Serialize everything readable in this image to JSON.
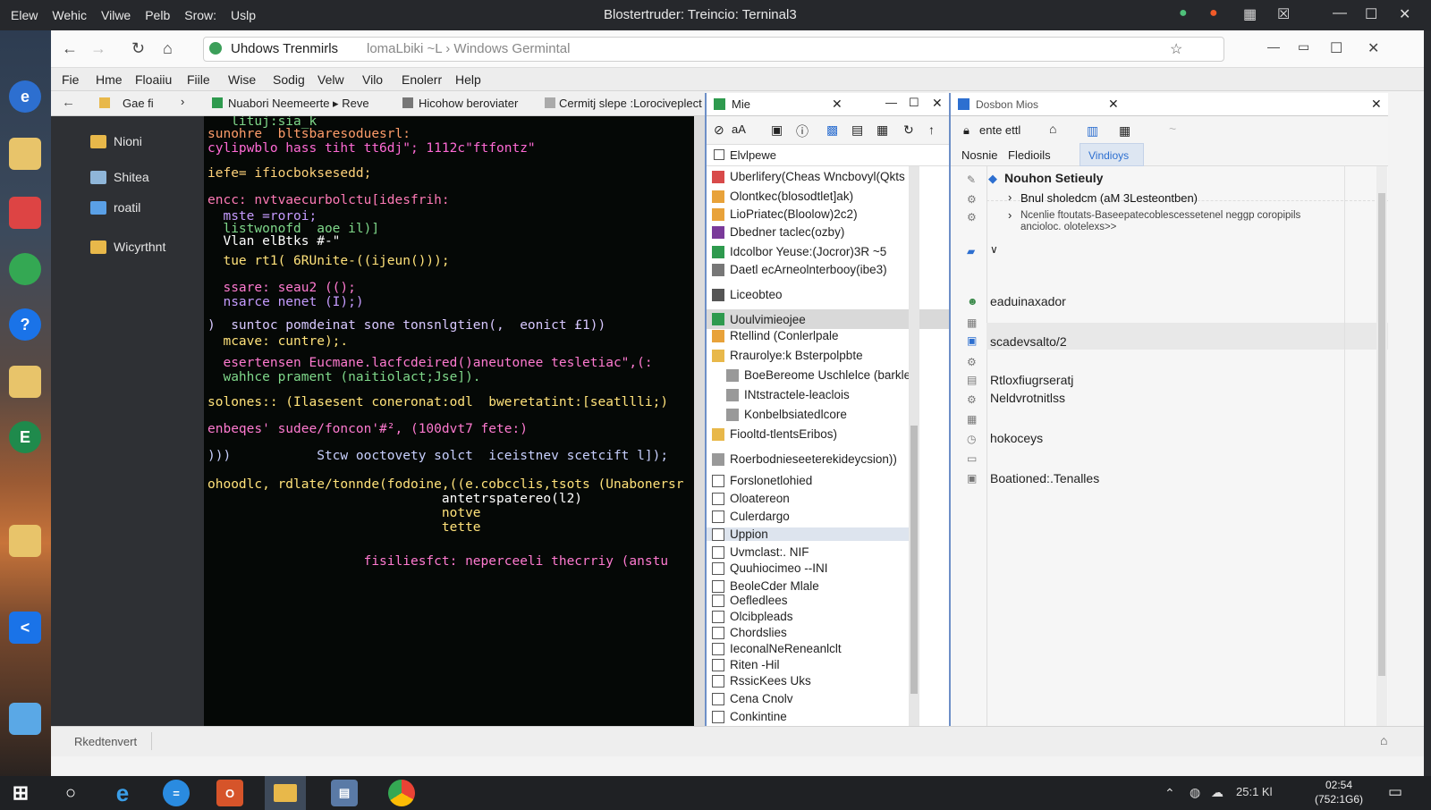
{
  "titlebar": {
    "menu": [
      "Elew",
      "Wehic",
      "Vilwe",
      "Pelb",
      "Srow:",
      "Uslp"
    ],
    "title": "Blostertruder: Treincio: Terninal3"
  },
  "browser": {
    "url_text": "Uhdows Trenmirls",
    "url_extra": "lomaLbiki ~L › Windows Germintal",
    "menu": [
      "Fie",
      "Hme",
      "Floaiiu",
      "Fiile",
      "Wise",
      "Sodig",
      "Velw",
      "Vilo",
      "Enolerr",
      "Help"
    ],
    "tabs": [
      "Gae fi",
      "Nuabori Neemeerte ▸ Reve",
      "Hicohow beroviater",
      "Cermitj slepe :Lorociveplect"
    ]
  },
  "sidebar": {
    "items": [
      "Nioni",
      "Shitea",
      "roatil",
      "Wicyrthnt"
    ]
  },
  "terminal": {
    "lines": [
      {
        "t": "   lituj:sia_k",
        "c": "#7fd88a"
      },
      {
        "t": "sunohre  bltsbaresoduesrl:",
        "c": "#ff9d6a"
      },
      {
        "t": "cylipwblo hass tiht tt6dj\"; 1112c\"ftfontz\"",
        "c": "#ff6ad5"
      },
      {
        "t": "iefe= ifiocboksesedd;",
        "c": "#ffd27a"
      },
      {
        "t": "encc: nvtvaecurbolctu[idesfrih:",
        "c": "#ff7ab6"
      },
      {
        "t": "  mste =roroi;",
        "c": "#c69cff"
      },
      {
        "t": "  listwonofd  aoe il)]",
        "c": "#7fd88a"
      },
      {
        "t": "  Vlan elBtks #-\"",
        "c": "#ffffff"
      },
      {
        "t": "  tue rt1( 6RUnite-((ijeun()));",
        "c": "#ffe27a"
      },
      {
        "t": "  ssare: seau2 (();",
        "c": "#ff7ad0"
      },
      {
        "t": "  nsarce nenet (I);)",
        "c": "#c69cff"
      },
      {
        "t": ")  suntoc pomdeinat sone tonsnlgtien(,  eonict £1))",
        "c": "#d8c8ff"
      },
      {
        "t": "  mcave: cuntre);.",
        "c": "#ffe27a"
      },
      {
        "t": "  esertensen Eucmane.lacfcdeired()aneutonee tesletiac\",(:",
        "c": "#ff7ad0"
      },
      {
        "t": "  wahhce prament (naitiolact;Jse]).",
        "c": "#7fd88a"
      },
      {
        "t": "solones:: (Ilasesent coneronat:odl  bweretatint:[seatllli;)",
        "c": "#ffe27a"
      },
      {
        "t": "enbeqes' sudee/foncon'#², (100dvt7 fete:)",
        "c": "#ff7ad0"
      },
      {
        "t": ")))           Stcw ooctovety solct  iceistnev scetcift l]);",
        "c": "#c8d0ff"
      },
      {
        "t": "ohoodlc, rdlate/tonnde(fodoine,((e.cobcclis,tsots (Unabonersr",
        "c": "#ffe27a"
      },
      {
        "t": "                              antetrspatereo(l2)",
        "c": "#ffffff"
      },
      {
        "t": "                              notve",
        "c": "#ffe27a"
      },
      {
        "t": "                              tette",
        "c": "#ffe27a"
      },
      {
        "t": "                    fisiliesfct: neperceeli thecrriy (anstu",
        "c": "#ff7ad0"
      }
    ]
  },
  "panel2": {
    "title": "Mie",
    "breadcrumb": "Elvlpewe",
    "items": [
      "Uberlifery(Cheas Wncbovyl(Qkts",
      "Olontkec(blosodtlet]ak)",
      "LioPriatec(Bloolow)2c2)",
      "Dbedner taclec(ozby)",
      "Idcolbor Yeuse:(Jocror)3R ~5",
      "Daetl ecArneolnterbooy(ibe3)",
      "Liceobteo",
      "Uoulvimieojee",
      "Rtellind (Conlerlpale",
      "Rraurolye:k Bsterpolpbte",
      "BoeBereome Uschlelce (barkle)",
      "INtstractele-leaclois",
      "Konbelbsiatedlcore",
      "Fiooltd-tlentsEribos)",
      "Roerbodnieseeterekideycsion))",
      "Forslonetlohied",
      "Oloatereon",
      "Culerdargo",
      "Uppion",
      "Uvmclast:. NIF",
      "Quuhiocimeo --INI",
      "BeoleCder Mlale",
      "Oefledlees",
      "Olcibpleads",
      "Chordslies",
      "IeconalNeReneanlclt",
      "Riten -Hil",
      "RssicKees Uks",
      "Cena Cnolv",
      "Conkintine"
    ]
  },
  "panel3": {
    "title": "Dosbon Mios",
    "toolbar_label": "ente ettl",
    "tabs": [
      "Nosnie",
      "Fledioils",
      "Vindioys"
    ],
    "tree_header": "Nouhon Setieuly",
    "tree_child": "Bnul sholedcm (aM 3Lesteontben)",
    "tree_desc": "Ncenlie ftoutats-Baseepatecoblescessetenel neggp coropipils ancioloc. olotelexs>>",
    "items": [
      "eaduinaxador",
      "scadevsalto/2",
      "Rtloxfiugrseratj",
      "Neldvrotnitlss",
      "hokoceys",
      "Boationed:.Tenalles"
    ]
  },
  "status": {
    "text": "Rkedtenvert"
  },
  "tray": {
    "time": "02:54",
    "date": "(752:1G6)",
    "extra": "25:1 Kl"
  }
}
